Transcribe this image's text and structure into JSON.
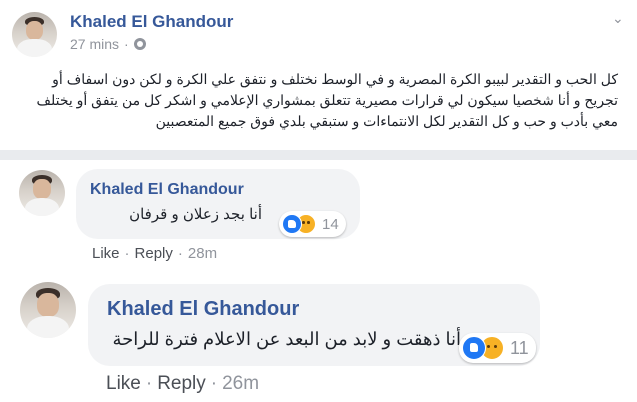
{
  "post": {
    "author": "Khaled El Ghandour",
    "time": "27 mins",
    "text": "كل الحب و التقدير لبيبو الكرة المصرية و في الوسط نختلف و نتفق علي الكرة و لكن دون اسفاف أو تجريح و أنا شخصيا سيكون لي قرارات مصيرية تتعلق بمشواري الإعلامي و اشكر كل من يتفق أو يختلف معي بأدب و حب و كل التقدير لكل الانتماءات و ستبقي بلدي فوق جميع المتعصبين"
  },
  "comments": [
    {
      "author": "Khaled El Ghandour",
      "text": "أنا بجد زعلان و قرفان",
      "reaction_count": "14",
      "like_label": "Like",
      "reply_label": "Reply",
      "time": "28m"
    },
    {
      "author": "Khaled El Ghandour",
      "text": "أنا ذهقت و لابد من البعد عن الاعلام فترة للراحة",
      "reaction_count": "11",
      "like_label": "Like",
      "reply_label": "Reply",
      "time": "26m"
    }
  ],
  "reactions": [
    "like-icon",
    "sad-icon"
  ],
  "colors": {
    "link": "#365899",
    "bubble": "#f2f3f5",
    "muted": "#90949c",
    "divider": "#e9ebee",
    "like": "#2078f4",
    "sad": "#f7b125"
  }
}
